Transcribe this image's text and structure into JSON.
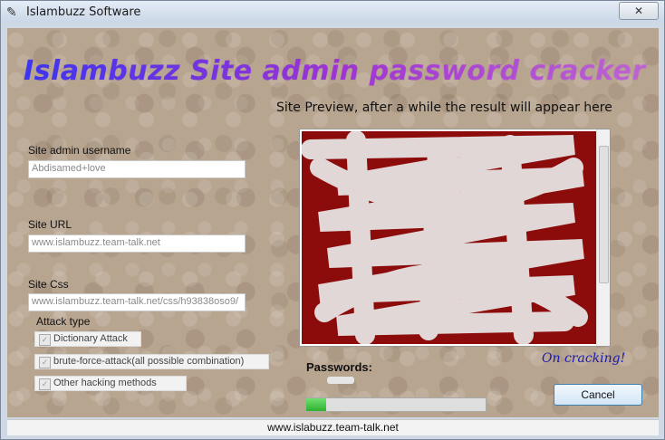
{
  "window": {
    "title": "Islambuzz Software",
    "close_label": "✕"
  },
  "header": {
    "headline": "Islambuzz Site admin password cracker",
    "preview_caption": "Site Preview, after a while the result will appear here"
  },
  "form": {
    "username_label": "Site admin username",
    "username_value": "Abdisamed+love",
    "url_label": "Site URL",
    "url_value": "www.islambuzz.team-talk.net",
    "css_label": "Site Css",
    "css_value": "www.islambuzz.team-talk.net/css/h93838oso9/"
  },
  "attack": {
    "title": "Attack type",
    "options": [
      {
        "label": "Dictionary Attack",
        "checked": true
      },
      {
        "label": "brute-force-attack(all possible combination)",
        "checked": true
      },
      {
        "label": "Other hacking methods",
        "checked": true
      }
    ]
  },
  "status": {
    "cracking_text": "On cracking!",
    "passwords_label": "Passwords:",
    "progress": 0.11,
    "cancel_label": "Cancel"
  },
  "footer": {
    "url": "www.islabuzz.team-talk.net"
  },
  "colors": {
    "preview_bg": "#8c0c0c",
    "progress_fill": "#2fb12f",
    "headline_start": "#3a3bff",
    "headline_end": "#f07dd6"
  }
}
